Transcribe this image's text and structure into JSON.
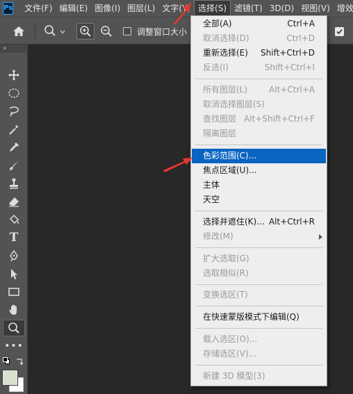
{
  "app": {
    "logo": "Ps"
  },
  "menubar": {
    "items": [
      "文件(F)",
      "编辑(E)",
      "图像(I)",
      "图层(L)",
      "文字(Y)",
      "选择(S)",
      "滤镜(T)",
      "3D(D)",
      "视图(V)",
      "增效工"
    ]
  },
  "options": {
    "checkbox_label": "调整窗口大小"
  },
  "dropdown": {
    "items": [
      {
        "label": "全部(A)",
        "shortcut": "Ctrl+A",
        "disabled": false
      },
      {
        "label": "取消选择(D)",
        "shortcut": "Ctrl+D",
        "disabled": true
      },
      {
        "label": "重新选择(E)",
        "shortcut": "Shift+Ctrl+D",
        "disabled": false
      },
      {
        "label": "反选(I)",
        "shortcut": "Shift+Ctrl+I",
        "disabled": true
      },
      {
        "label": "所有图层(L)",
        "shortcut": "Alt+Ctrl+A",
        "disabled": true
      },
      {
        "label": "取消选择图层(S)",
        "shortcut": "",
        "disabled": true
      },
      {
        "label": "查找图层",
        "shortcut": "Alt+Shift+Ctrl+F",
        "disabled": true
      },
      {
        "label": "隔离图层",
        "shortcut": "",
        "disabled": true
      },
      {
        "label": "色彩范围(C)...",
        "shortcut": "",
        "disabled": false,
        "highlighted": true
      },
      {
        "label": "焦点区域(U)...",
        "shortcut": "",
        "disabled": false
      },
      {
        "label": "主体",
        "shortcut": "",
        "disabled": false
      },
      {
        "label": "天空",
        "shortcut": "",
        "disabled": false
      },
      {
        "label": "选择并遮住(K)...",
        "shortcut": "Alt+Ctrl+R",
        "disabled": false
      },
      {
        "label": "修改(M)",
        "shortcut": "",
        "disabled": true,
        "submenu": true
      },
      {
        "label": "扩大选取(G)",
        "shortcut": "",
        "disabled": true
      },
      {
        "label": "选取相似(R)",
        "shortcut": "",
        "disabled": true
      },
      {
        "label": "变换选区(T)",
        "shortcut": "",
        "disabled": true
      },
      {
        "label": "在快速蒙版模式下编辑(Q)",
        "shortcut": "",
        "disabled": false
      },
      {
        "label": "载入选区(O)...",
        "shortcut": "",
        "disabled": true
      },
      {
        "label": "存储选区(V)...",
        "shortcut": "",
        "disabled": true
      },
      {
        "label": "新建 3D 模型(3)",
        "shortcut": "",
        "disabled": true
      }
    ]
  },
  "toolbar": {
    "tools": [
      "move-tool",
      "marquee-tool",
      "lasso-tool",
      "magic-wand-tool",
      "eyedropper-tool",
      "brush-tool",
      "clone-stamp-tool",
      "eraser-tool",
      "paint-bucket-tool",
      "type-tool",
      "pen-tool",
      "path-selection-tool",
      "rectangle-tool",
      "hand-tool",
      "zoom-tool",
      "more-tools"
    ],
    "selected": "zoom-tool"
  },
  "colors": {
    "highlight": "#0a64c2",
    "arrow": "#e8372e",
    "foreground": "#d8e0cf",
    "background": "#ffffff"
  }
}
